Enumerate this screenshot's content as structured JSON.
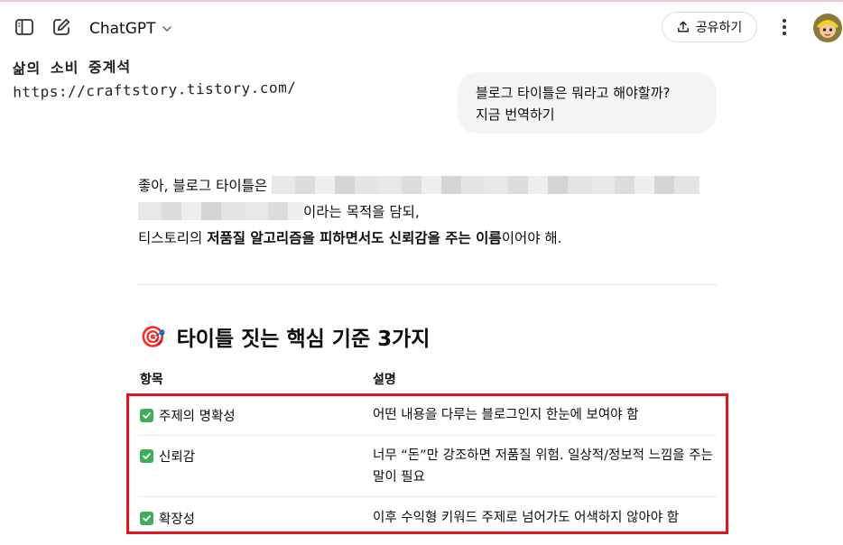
{
  "header": {
    "model_name": "ChatGPT",
    "share_label": "공유하기",
    "icons": [
      "sidebar-toggle-icon",
      "new-chat-icon",
      "chevron-down-icon",
      "share-icon",
      "more-vertical-icon"
    ]
  },
  "watermark": {
    "line1": "삶의 소비 중계석",
    "line2": "https://craftstory.tistory.com/"
  },
  "user_message": {
    "line1": "블로그 타이틀은 뭐라고 해야할까?",
    "line2": "지금 번역하기"
  },
  "answer": {
    "p1_start": "좋아, 블로그 타이틀은",
    "p1_end": "이라는 목적을 담되,",
    "p2_prefix": "티스토리의 ",
    "p2_bold": "저품질 알고리즘을 피하면서도 신뢰감을 주는 이름",
    "p2_suffix": "이어야 해."
  },
  "section": {
    "emoji": "🎯",
    "title": "타이틀 짓는 핵심 기준 3가지"
  },
  "table": {
    "headers": [
      "항목",
      "설명"
    ],
    "rows": [
      {
        "item": "주제의 명확성",
        "desc": "어떤 내용을 다루는 블로그인지 한눈에 보여야 함"
      },
      {
        "item": "신뢰감",
        "desc": "너무 “돈”만 강조하면 저품질 위험. 일상적/정보적 느낌을 주는 말이 필요"
      },
      {
        "item": "확장성",
        "desc": "이후 수익형 키워드 주제로 넘어가도 어색하지 않아야 함"
      }
    ]
  },
  "colors": {
    "highlight_box": "#e0141b",
    "check_green": "#3fae5a",
    "bubble_bg": "#f4f4f4"
  }
}
